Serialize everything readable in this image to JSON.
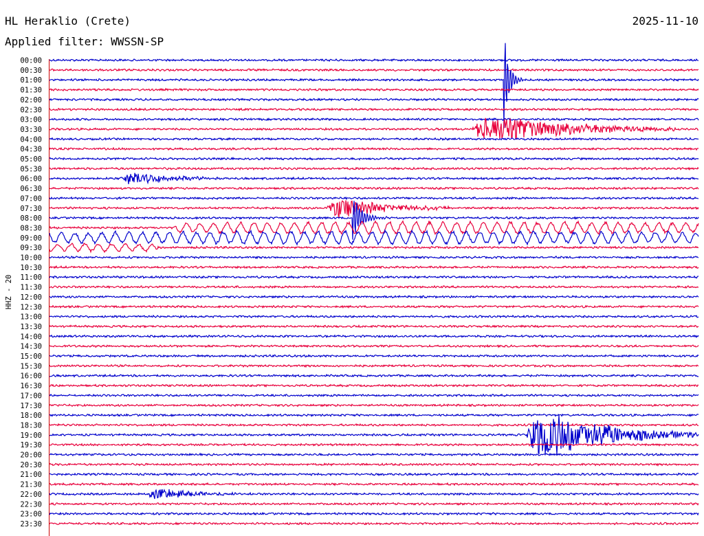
{
  "header": {
    "station": "HL Heraklio (Crete)",
    "date": "2025-11-10",
    "filter": "Applied filter: WWSSN-SP"
  },
  "channel_label": "HHZ - 20",
  "chart_data": {
    "type": "line",
    "title": "HL Heraklio (Crete)",
    "subtitle": "Applied filter: WWSSN-SP",
    "date": "2025-11-10",
    "ylabel": "HHZ - 20",
    "row_minutes": 30,
    "colors": {
      "even_rows": "#0000cc",
      "odd_rows": "#e8003c",
      "axis": "#cc0000",
      "text": "#000000"
    },
    "tick_labels": [
      "00:00",
      "00:30",
      "01:00",
      "01:30",
      "02:00",
      "02:30",
      "03:00",
      "03:30",
      "04:00",
      "04:30",
      "05:00",
      "05:30",
      "06:00",
      "06:30",
      "07:00",
      "07:30",
      "08:00",
      "08:30",
      "09:00",
      "09:30",
      "10:00",
      "10:30",
      "11:00",
      "11:30",
      "12:00",
      "12:30",
      "13:00",
      "13:30",
      "14:00",
      "14:30",
      "15:00",
      "15:30",
      "16:00",
      "16:30",
      "17:00",
      "17:30",
      "18:00",
      "18:30",
      "19:00",
      "19:30",
      "20:00",
      "20:30",
      "21:00",
      "21:30",
      "22:00",
      "22:30",
      "23:00",
      "23:30"
    ],
    "events": [
      {
        "row": 2,
        "start_min": 21.0,
        "duration_min": 1.2,
        "peak": 10,
        "kind": "spike"
      },
      {
        "row": 7,
        "start_min": 19.5,
        "duration_min": 9.5,
        "peak": 4.2,
        "kind": "quake"
      },
      {
        "row": 12,
        "start_min": 3.3,
        "duration_min": 4.5,
        "peak": 1.8,
        "kind": "quake"
      },
      {
        "row": 15,
        "start_min": 12.8,
        "duration_min": 6.0,
        "peak": 3.0,
        "kind": "quake"
      },
      {
        "row": 16,
        "start_min": 14.0,
        "duration_min": 2.0,
        "peak": 5.5,
        "kind": "spike"
      },
      {
        "row": 17,
        "start_min": 5.8,
        "duration_min": 24.2,
        "peak": 1.2,
        "kind": "swell"
      },
      {
        "row": 18,
        "start_min": 0.0,
        "duration_min": 30.0,
        "peak": 1.3,
        "kind": "swell"
      },
      {
        "row": 19,
        "start_min": 0.0,
        "duration_min": 5.0,
        "peak": 0.8,
        "kind": "swell"
      },
      {
        "row": 38,
        "start_min": 22.0,
        "duration_min": 8.0,
        "peak": 7.0,
        "kind": "quake"
      },
      {
        "row": 44,
        "start_min": 4.5,
        "duration_min": 5.0,
        "peak": 1.6,
        "kind": "quake"
      }
    ]
  }
}
